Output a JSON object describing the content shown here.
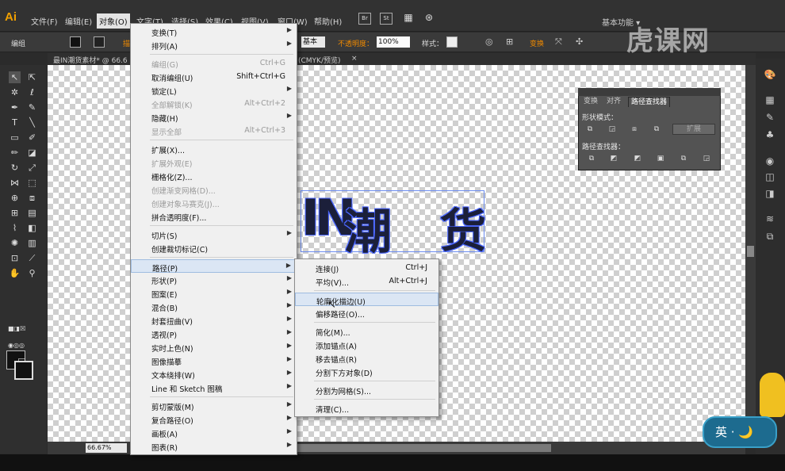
{
  "menubar": {
    "logo": "Ai",
    "items": [
      "文件(F)",
      "编辑(E)",
      "对象(O)",
      "文字(T)",
      "选择(S)",
      "效果(C)",
      "视图(V)",
      "窗口(W)",
      "帮助(H)"
    ],
    "app_icons": [
      "Br",
      "St"
    ],
    "workspace": "基本功能 ▾"
  },
  "control": {
    "group_label": "编组",
    "stroke_label": "描",
    "basic": "基本",
    "opacity_label": "不透明度：",
    "opacity_value": "100%",
    "style_label": "样式：",
    "transform": "变换"
  },
  "document": {
    "tab1": "最IN潮货素材* @ 66.6",
    "tab2_suffix": "(CMYK/预览)",
    "close": "×"
  },
  "status": {
    "zoom": "66.67%"
  },
  "artwork": {
    "chars": [
      "IN",
      "潮",
      "货"
    ]
  },
  "pathfinder": {
    "tabs": [
      "变换",
      "对齐",
      "路径查找器"
    ],
    "shape_modes": "形状模式：",
    "pathfinders": "路径查找器：",
    "expand": "扩展"
  },
  "object_menu": {
    "items": [
      {
        "label": "变换(T)",
        "shortcut": "",
        "sub": true,
        "disabled": false
      },
      {
        "label": "排列(A)",
        "shortcut": "",
        "sub": true,
        "disabled": false
      },
      {
        "sep": true
      },
      {
        "label": "编组(G)",
        "shortcut": "Ctrl+G",
        "sub": false,
        "disabled": true
      },
      {
        "label": "取消编组(U)",
        "shortcut": "Shift+Ctrl+G",
        "sub": false,
        "disabled": false
      },
      {
        "label": "锁定(L)",
        "shortcut": "",
        "sub": true,
        "disabled": false
      },
      {
        "label": "全部解锁(K)",
        "shortcut": "Alt+Ctrl+2",
        "sub": false,
        "disabled": true
      },
      {
        "label": "隐藏(H)",
        "shortcut": "",
        "sub": true,
        "disabled": false
      },
      {
        "label": "显示全部",
        "shortcut": "Alt+Ctrl+3",
        "sub": false,
        "disabled": true
      },
      {
        "sep": true
      },
      {
        "label": "扩展(X)...",
        "shortcut": "",
        "sub": false,
        "disabled": false
      },
      {
        "label": "扩展外观(E)",
        "shortcut": "",
        "sub": false,
        "disabled": true
      },
      {
        "label": "栅格化(Z)...",
        "shortcut": "",
        "sub": false,
        "disabled": false
      },
      {
        "label": "创建渐变网格(D)...",
        "shortcut": "",
        "sub": false,
        "disabled": true
      },
      {
        "label": "创建对象马赛克(J)...",
        "shortcut": "",
        "sub": false,
        "disabled": true
      },
      {
        "label": "拼合透明度(F)...",
        "shortcut": "",
        "sub": false,
        "disabled": false
      },
      {
        "sep": true
      },
      {
        "label": "切片(S)",
        "shortcut": "",
        "sub": true,
        "disabled": false
      },
      {
        "label": "创建裁切标记(C)",
        "shortcut": "",
        "sub": false,
        "disabled": false
      },
      {
        "sep": true
      },
      {
        "label": "路径(P)",
        "shortcut": "",
        "sub": true,
        "disabled": false,
        "hl": true
      },
      {
        "label": "形状(P)",
        "shortcut": "",
        "sub": true,
        "disabled": false
      },
      {
        "label": "图案(E)",
        "shortcut": "",
        "sub": true,
        "disabled": false
      },
      {
        "label": "混合(B)",
        "shortcut": "",
        "sub": true,
        "disabled": false
      },
      {
        "label": "封套扭曲(V)",
        "shortcut": "",
        "sub": true,
        "disabled": false
      },
      {
        "label": "透视(P)",
        "shortcut": "",
        "sub": true,
        "disabled": false
      },
      {
        "label": "实时上色(N)",
        "shortcut": "",
        "sub": true,
        "disabled": false
      },
      {
        "label": "图像描摹",
        "shortcut": "",
        "sub": true,
        "disabled": false
      },
      {
        "label": "文本绕排(W)",
        "shortcut": "",
        "sub": true,
        "disabled": false
      },
      {
        "label": "Line 和 Sketch 图稿",
        "shortcut": "",
        "sub": true,
        "disabled": false
      },
      {
        "sep": true
      },
      {
        "label": "剪切蒙版(M)",
        "shortcut": "",
        "sub": true,
        "disabled": false
      },
      {
        "label": "复合路径(O)",
        "shortcut": "",
        "sub": true,
        "disabled": false
      },
      {
        "label": "画板(A)",
        "shortcut": "",
        "sub": true,
        "disabled": false
      },
      {
        "label": "图表(R)",
        "shortcut": "",
        "sub": true,
        "disabled": false
      }
    ]
  },
  "path_menu": {
    "items": [
      {
        "label": "连接(J)",
        "shortcut": "Ctrl+J"
      },
      {
        "label": "平均(V)...",
        "shortcut": "Alt+Ctrl+J"
      },
      {
        "sep": true
      },
      {
        "label": "轮廓化描边(U)",
        "shortcut": "",
        "hl": true
      },
      {
        "label": "偏移路径(O)...",
        "shortcut": ""
      },
      {
        "sep": true
      },
      {
        "label": "简化(M)...",
        "shortcut": ""
      },
      {
        "label": "添加锚点(A)",
        "shortcut": ""
      },
      {
        "label": "移去锚点(R)",
        "shortcut": ""
      },
      {
        "label": "分割下方对象(D)",
        "shortcut": ""
      },
      {
        "sep": true
      },
      {
        "label": "分割为网格(S)...",
        "shortcut": ""
      },
      {
        "sep": true
      },
      {
        "label": "清理(C)...",
        "shortcut": ""
      }
    ]
  },
  "overlay": {
    "watermark": "虎课网",
    "badge": "英 · 🌙"
  }
}
